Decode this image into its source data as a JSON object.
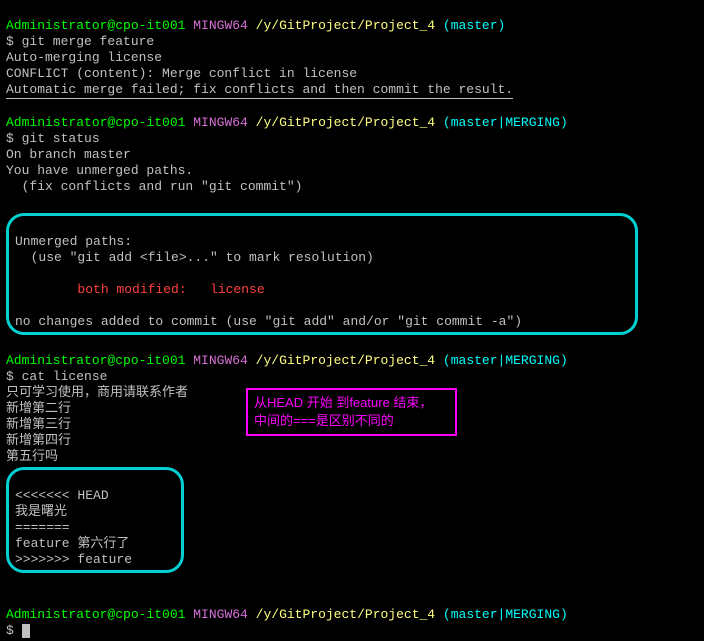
{
  "prompt1": {
    "user": "Administrator@cpo-it001",
    "mingw": "MINGW64",
    "path": "/y/GitProject/Project_4",
    "branch": "(master)"
  },
  "block1": {
    "cmd": "$ git merge feature",
    "l1": "Auto-merging license",
    "l2": "CONFLICT (content): Merge conflict in license",
    "l3": "Automatic merge failed; fix conflicts and then commit the result."
  },
  "prompt2": {
    "user": "Administrator@cpo-it001",
    "mingw": "MINGW64",
    "path": "/y/GitProject/Project_4",
    "branch": "(master|MERGING)"
  },
  "block2": {
    "cmd": "$ git status",
    "l1": "On branch master",
    "l2": "You have unmerged paths.",
    "l3": "  (fix conflicts and run \"git commit\")"
  },
  "box1": {
    "l1": "Unmerged paths:",
    "l2": "  (use \"git add <file>...\" to mark resolution)",
    "l3": "        both modified:   license",
    "l4": "no changes added to commit (use \"git add\" and/or \"git commit -a\")"
  },
  "prompt3": {
    "user": "Administrator@cpo-it001",
    "mingw": "MINGW64",
    "path": "/y/GitProject/Project_4",
    "branch": "(master|MERGING)"
  },
  "block3": {
    "cmd": "$ cat license",
    "l1": "只可学习使用，商用请联系作者",
    "l2": "新增第二行",
    "l3": "新增第三行",
    "l4": "新增第四行",
    "l5": "第五行吗"
  },
  "box2": {
    "l1": "<<<<<<< HEAD",
    "l2": "我是曙光",
    "l3": "=======",
    "l4": "feature 第六行了",
    "l5": ">>>>>>> feature"
  },
  "annotation": {
    "l1": "从HEAD 开始 到feature 结束，",
    "l2": "中间的===是区别不同的"
  },
  "prompt4": {
    "user": "Administrator@cpo-it001",
    "mingw": "MINGW64",
    "path": "/y/GitProject/Project_4",
    "branch": "(master|MERGING)"
  },
  "block4": {
    "cmd": "$"
  }
}
